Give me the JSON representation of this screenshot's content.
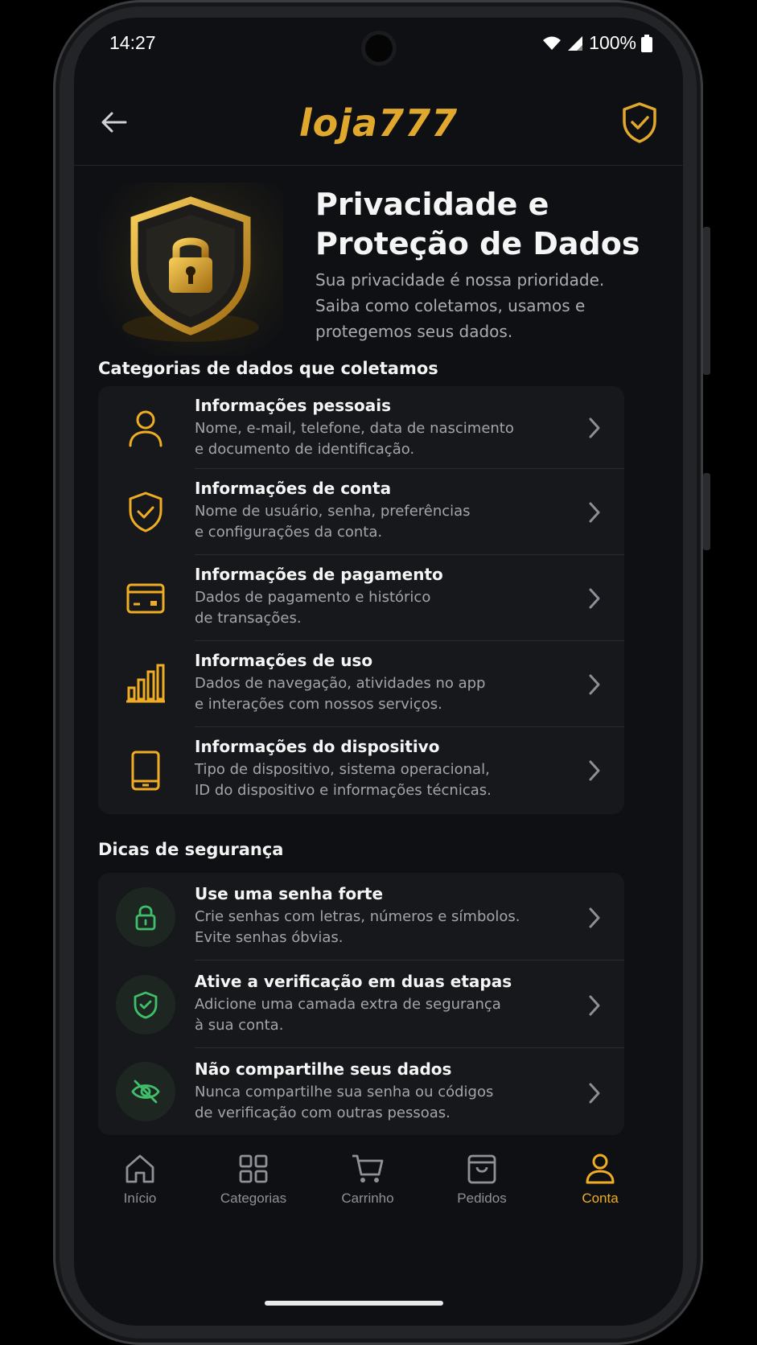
{
  "status_bar": {
    "time": "14:27",
    "battery": "100%"
  },
  "header": {
    "logo": "loja777"
  },
  "hero": {
    "title_line1": "Privacidade e",
    "title_line2": "Proteção de Dados",
    "subtitle": "Sua privacidade é nossa prioridade. Saiba como coletamos, usamos e protegemos seus dados."
  },
  "categories": {
    "title": "Categorias de dados que coletamos",
    "items": [
      {
        "icon": "person-icon",
        "title": "Informações pessoais",
        "desc1": "Nome, e-mail, telefone, data de nascimento",
        "desc2": "e documento de identificação."
      },
      {
        "icon": "shield-check-icon",
        "title": "Informações de conta",
        "desc1": "Nome de usuário, senha, preferências",
        "desc2": "e configurações da conta."
      },
      {
        "icon": "credit-card-icon",
        "title": "Informações de pagamento",
        "desc1": "Dados de pagamento e histórico",
        "desc2": "de transações."
      },
      {
        "icon": "bar-chart-icon",
        "title": "Informações de uso",
        "desc1": "Dados de navegação, atividades no app",
        "desc2": "e interações com nossos serviços."
      },
      {
        "icon": "tablet-icon",
        "title": "Informações do dispositivo",
        "desc1": "Tipo de dispositivo, sistema operacional,",
        "desc2": "ID do dispositivo e informações técnicas."
      }
    ]
  },
  "tips": {
    "title": "Dicas de segurança",
    "items": [
      {
        "icon": "lock-icon",
        "title": "Use uma senha forte",
        "desc1": "Crie senhas com letras, números e símbolos.",
        "desc2": "Evite senhas óbvias."
      },
      {
        "icon": "shield-check-icon",
        "title": "Ative a verificação em duas etapas",
        "desc1": "Adicione uma camada extra de segurança",
        "desc2": "à sua conta."
      },
      {
        "icon": "eye-off-icon",
        "title": "Não compartilhe seus dados",
        "desc1": "Nunca compartilhe sua senha ou códigos",
        "desc2": "de verificação com outras pessoas."
      }
    ]
  },
  "tabs": [
    {
      "icon": "home-icon",
      "label": "Início"
    },
    {
      "icon": "grid-icon",
      "label": "Categorias"
    },
    {
      "icon": "cart-icon",
      "label": "Carrinho"
    },
    {
      "icon": "box-icon",
      "label": "Pedidos"
    },
    {
      "icon": "user-icon",
      "label": "Conta",
      "active": true
    }
  ],
  "colors": {
    "accent": "#f0ad23",
    "green": "#3fbf6a",
    "background": "#0f1013",
    "card": "#17181c"
  }
}
